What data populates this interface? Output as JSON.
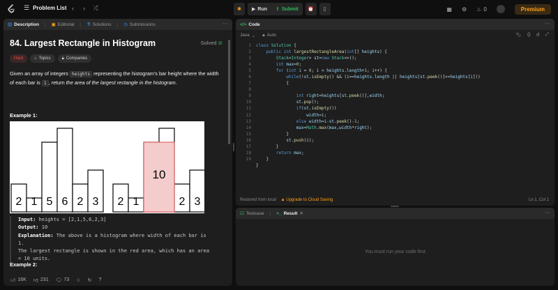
{
  "topbar": {
    "problem_list_label": "Problem List",
    "run_label": "Run",
    "submit_label": "Submit",
    "coins": "0",
    "premium_label": "Premium"
  },
  "description_panel": {
    "tabs": [
      "Description",
      "Editorial",
      "Solutions",
      "Submissions"
    ],
    "title": "84. Largest Rectangle in Histogram",
    "solved_label": "Solved",
    "difficulty": "Hard",
    "topics_label": "Topics",
    "companies_label": "Companies",
    "statement_pre": "Given an array of integers ",
    "statement_code1": "heights",
    "statement_mid": " representing the histogram's bar height where the width of each bar is ",
    "statement_code2": "1",
    "statement_post": ", return ",
    "statement_italic": "the area of the largest rectangle in the histogram",
    "statement_end": ".",
    "example1_title": "Example 1:",
    "example1": {
      "input_label": "Input:",
      "input_value": " heights = [2,1,5,6,2,3]",
      "output_label": "Output:",
      "output_value": " 10",
      "explanation_label": "Explanation:",
      "explanation_line1": " The above is a histogram where width of each bar is",
      "explanation_line2": "1.",
      "explanation_line3": "The largest rectangle is shown in the red area, which has an area",
      "explanation_line4": "= 10 units."
    },
    "example2_title": "Example 2:",
    "footer": {
      "likes": "16K",
      "dislikes": "231",
      "comments": "73"
    }
  },
  "histogram": {
    "bars": [
      2,
      1,
      5,
      6,
      2,
      3
    ],
    "highlight_label": "10",
    "highlight_color": "#f4cccc",
    "highlight_border": "#e06666"
  },
  "code_panel": {
    "tab_label": "Code",
    "language": "Java",
    "auto_label": "Auto",
    "line_numbers": [
      "1",
      "2",
      "3",
      "4",
      "5",
      "6",
      "7",
      "8",
      "9",
      "10",
      "11",
      "12",
      "13",
      "14",
      "15",
      "16",
      "17",
      "18",
      "19"
    ],
    "restored_label": "Restored from local",
    "upgrade_label": "Upgrade to Cloud Saving",
    "cursor_pos": "Ln 1, Col 1"
  },
  "test_panel": {
    "testcase_label": "Testcase",
    "result_label": "Result",
    "empty_message": "You must run your code first"
  },
  "colors": {
    "accent": "#ffa116",
    "solved_green": "#2cbb5d",
    "hard_red": "#ef4743"
  }
}
